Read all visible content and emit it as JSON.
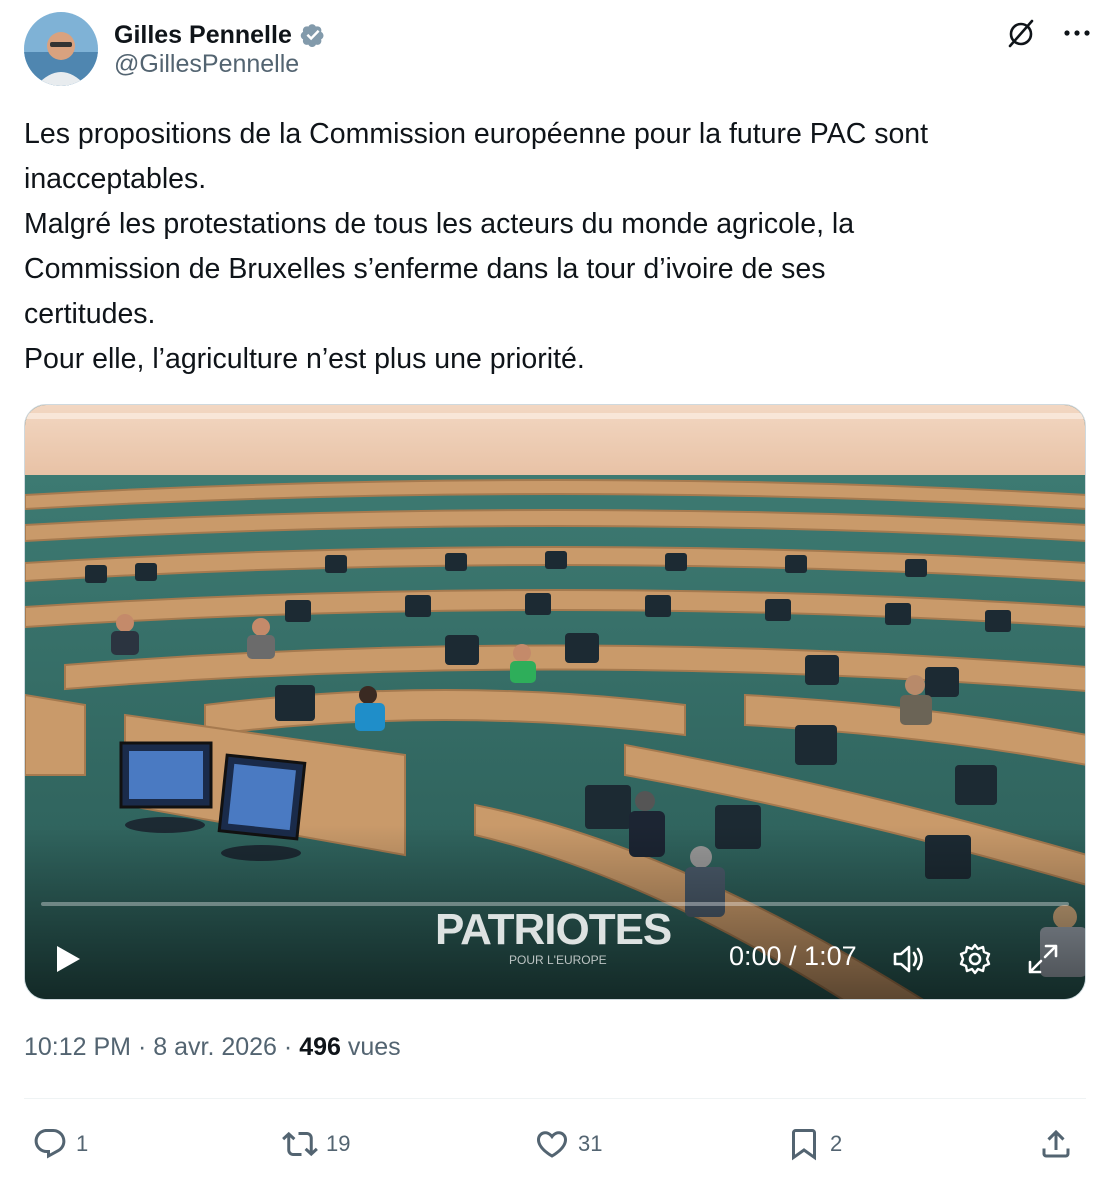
{
  "author": {
    "name": "Gilles Pennelle",
    "handle": "@GillesPennelle",
    "verified": true
  },
  "tweet": {
    "lines": [
      "Les propositions de la Commission européenne pour la future PAC sont",
      "inacceptables.",
      "Malgré les protestations de tous les acteurs du monde agricole, la",
      "Commission de Bruxelles s’enferme dans la tour d’ivoire de ses",
      "certitudes.",
      "Pour elle, l’agriculture n’est plus une priorité."
    ]
  },
  "video": {
    "watermark": "PATRIOTES",
    "watermark_sub": "POUR L'EUROPE",
    "time": "0:00 / 1:07",
    "progress": 0,
    "controls": [
      "play-icon",
      "volume-icon",
      "settings-icon",
      "fullscreen-icon"
    ]
  },
  "meta": {
    "time": "10:12 PM",
    "date": "8 avr. 2026",
    "views_count": "496",
    "views_label": "vues",
    "separator": "·"
  },
  "actions": {
    "replies": "1",
    "reposts": "19",
    "likes": "31",
    "bookmarks": "2"
  },
  "colors": {
    "text": "#0f1419",
    "secondary": "#536471",
    "verified": "#829aab",
    "divider": "#eff3f4"
  }
}
